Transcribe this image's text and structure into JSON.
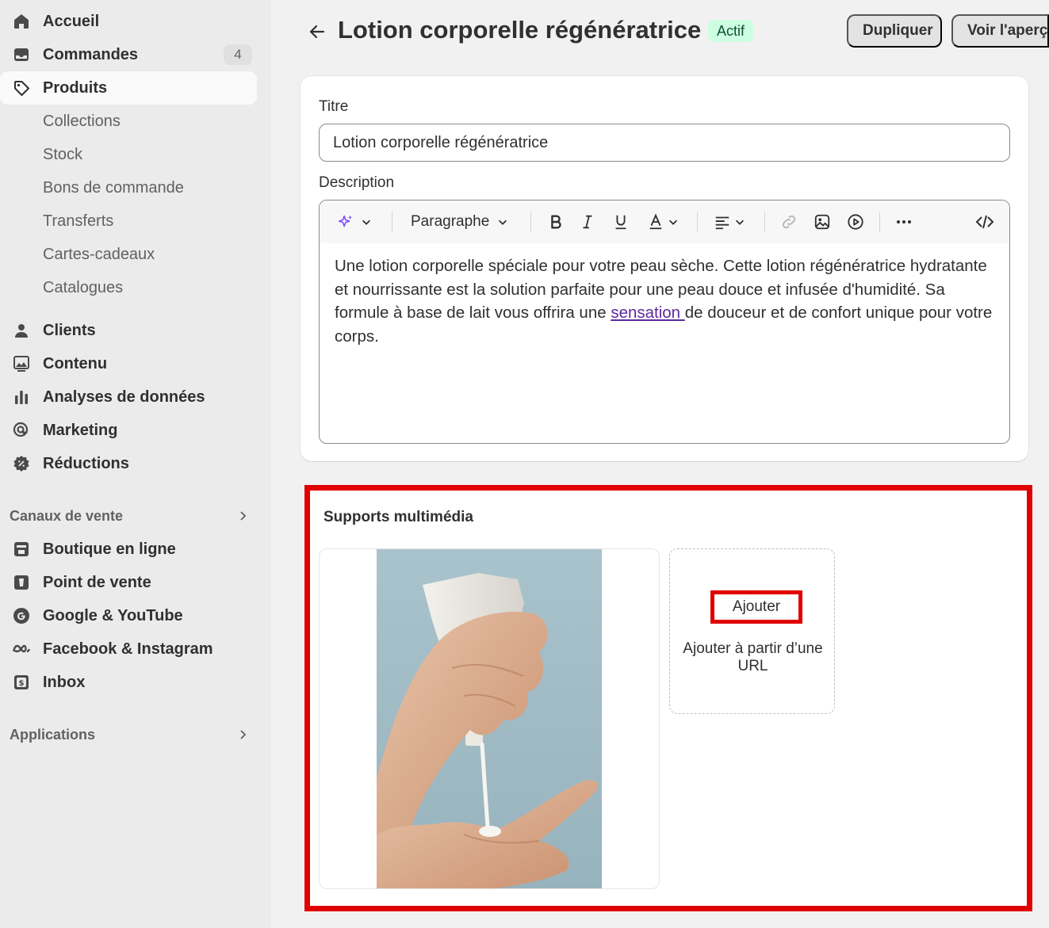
{
  "sidebar": {
    "home": "Accueil",
    "orders": {
      "label": "Commandes",
      "count": "4"
    },
    "products": "Produits",
    "sub_items": [
      "Collections",
      "Stock",
      "Bons de commande",
      "Transferts",
      "Cartes-cadeaux",
      "Catalogues"
    ],
    "customers": "Clients",
    "content": "Contenu",
    "analytics": "Analyses de données",
    "marketing": "Marketing",
    "discounts": "Réductions",
    "sales_channels": {
      "heading": "Canaux de vente",
      "items": [
        "Boutique en ligne",
        "Point de vente",
        "Google & YouTube",
        "Facebook & Instagram",
        "Inbox"
      ]
    },
    "apps_heading": "Applications"
  },
  "header": {
    "title": "Lotion corporelle régénératrice",
    "status": "Actif",
    "duplicate_label": "Dupliquer",
    "preview_label": "Voir l'aperçu"
  },
  "product_form": {
    "title_label": "Titre",
    "title_value": "Lotion corporelle régénératrice",
    "description_label": "Description",
    "toolbar": {
      "format_label": "Paragraphe"
    },
    "description": {
      "before_link": "Une lotion corporelle spéciale pour votre peau sèche. Cette lotion régénératrice hydratante et nourrissante est la solution parfaite pour une peau douce et infusée d'humidité. Sa formule à base de lait vous offrira une ",
      "link_text": "sensation ",
      "after_link": "de douceur et de confort unique pour votre corps."
    }
  },
  "media": {
    "title": "Supports multimédia",
    "add_label": "Ajouter",
    "add_from_url_label": "Ajouter à partir d’une URL"
  },
  "colors": {
    "sidebar_bg": "#ebebeb",
    "page_bg": "#f1f1f1",
    "status_bg": "#cdfee1",
    "status_text": "#0c5132",
    "highlight_red": "#e00000",
    "link": "#5c2a9b"
  },
  "icons": [
    "home-icon",
    "inbox-tray-icon",
    "tag-icon",
    "person-icon",
    "image-icon",
    "bar-chart-icon",
    "target-icon",
    "discount-icon",
    "chevron-right-icon",
    "store-icon",
    "pos-icon",
    "google-icon",
    "meta-icon",
    "inbox-dollar-icon",
    "arrow-left-icon",
    "magic-sparkle-icon",
    "chevron-down-icon",
    "bold-icon",
    "italic-icon",
    "underline-icon",
    "text-color-icon",
    "align-icon",
    "link-icon",
    "insert-image-icon",
    "insert-video-icon",
    "more-icon",
    "code-icon"
  ]
}
